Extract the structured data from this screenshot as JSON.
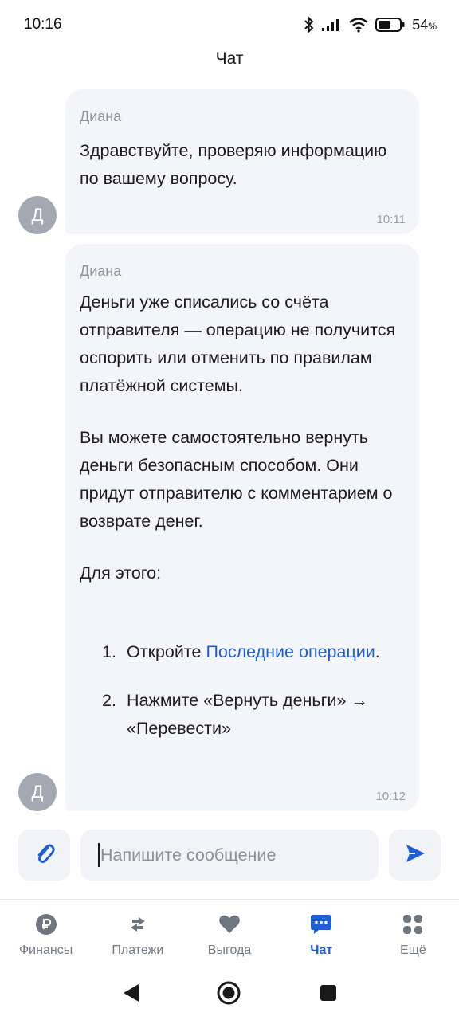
{
  "status_bar": {
    "time": "10:16",
    "battery_percent": "54",
    "battery_suffix": "%",
    "icons": [
      "bluetooth-icon",
      "signal-icon",
      "wifi-icon",
      "battery-icon"
    ]
  },
  "header": {
    "title": "Чат"
  },
  "messages": [
    {
      "avatar_letter": "Д",
      "sender": "Диана",
      "paragraphs": [
        "Здравствуйте, проверяю информацию по вашему вопросу."
      ],
      "time": "10:11"
    },
    {
      "avatar_letter": "Д",
      "sender": "Диана",
      "paragraphs": [
        "Деньги уже списались со счёта отправителя — операцию не получится оспорить или отменить по правилам платёжной системы.",
        "Вы можете самостоятельно вернуть деньги безопасным способом. Они придут отправителю с комментарием о возврате денег.",
        "Для этого:"
      ],
      "steps": [
        {
          "number": "1.",
          "prefix": "Откройте ",
          "link": "Последние операции",
          "suffix": "."
        },
        {
          "number": "2.",
          "text": "Нажмите «Вернуть деньги» → «Перевести»"
        }
      ],
      "time": "10:12"
    }
  ],
  "composer": {
    "placeholder": "Напишите сообщение",
    "attach_icon": "paperclip-icon",
    "send_icon": "send-icon"
  },
  "bottom_nav": {
    "active": "Чат",
    "items": [
      {
        "label": "Финансы",
        "icon": "ruble-icon"
      },
      {
        "label": "Платежи",
        "icon": "transfer-arrows-icon"
      },
      {
        "label": "Выгода",
        "icon": "heart-icon"
      },
      {
        "label": "Чат",
        "icon": "chat-bubble-icon"
      },
      {
        "label": "Ещё",
        "icon": "grid-icon"
      }
    ]
  },
  "colors": {
    "accent": "#1f5fd1",
    "bubble": "#f4f5f9",
    "avatar": "#a3a9b2"
  }
}
